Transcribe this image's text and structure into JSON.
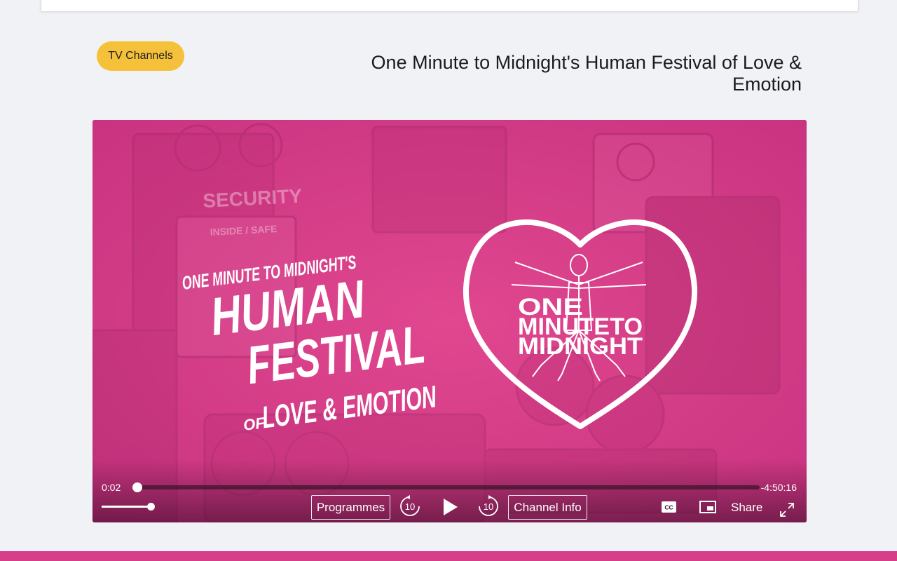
{
  "header": {
    "category_tag": "TV Channels",
    "title": "One Minute to Midnight's Human Festival of Love & Emotion"
  },
  "video": {
    "overlay": {
      "line1": "ONE MINUTE TO MIDNIGHT'S",
      "line2": "HUMAN",
      "line3": "FESTIVAL",
      "line4_small": "OF",
      "line4_big": "LOVE & EMOTION",
      "logo_line1": "ONE",
      "logo_line2": "MINUTETO",
      "logo_line3": "MIDNIGHT"
    },
    "background_texts": {
      "security": "SECURITY",
      "safe": "INSIDE / SAFE"
    }
  },
  "controls": {
    "elapsed": "0:02",
    "remaining": "-4:50:16",
    "progress": 0.0,
    "volume": 1.0,
    "programmes_label": "Programmes",
    "rewind_label": "10",
    "forward_label": "10",
    "channel_info_label": "Channel Info",
    "cc_label": "CC",
    "share_label": "Share"
  },
  "colors": {
    "video_pink": "#d63e8a",
    "tag_yellow": "#f5c13a",
    "background": "#f1f2f6"
  },
  "icons": {
    "play": "play-icon",
    "rewind": "rewind-10-icon",
    "forward": "forward-10-icon",
    "cc": "closed-captions-icon",
    "pip": "picture-in-picture-icon",
    "fullscreen": "fullscreen-icon"
  }
}
